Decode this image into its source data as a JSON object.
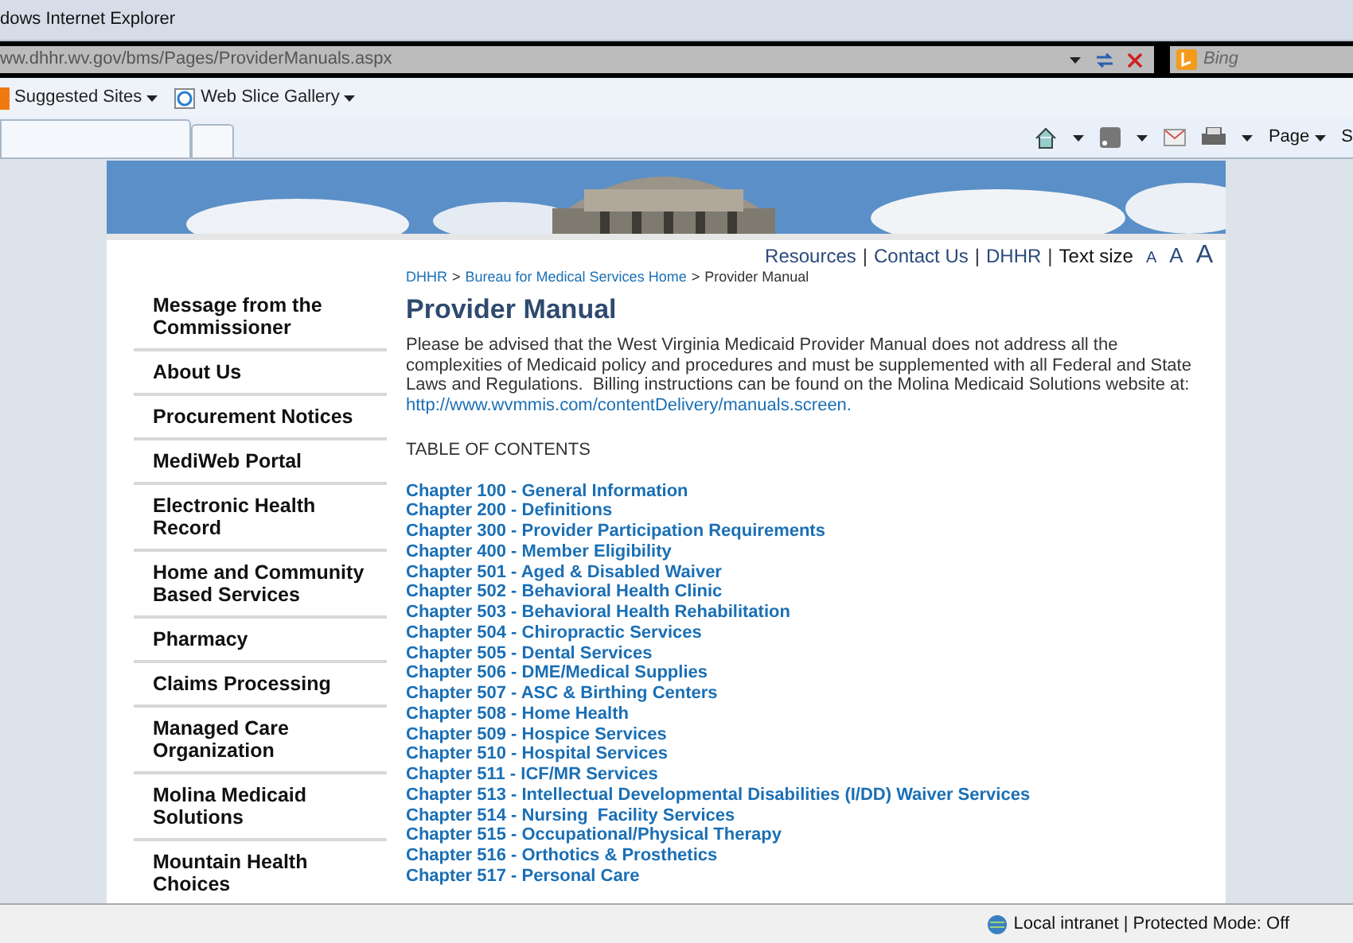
{
  "window": {
    "title": "dows Internet Explorer"
  },
  "address_bar": {
    "url": "ww.dhhr.wv.gov/bms/Pages/ProviderManuals.aspx"
  },
  "search": {
    "placeholder": "Bing"
  },
  "favorites_bar": [
    "Suggested Sites",
    "Web Slice Gallery"
  ],
  "command_bar": {
    "page_menu": "Page",
    "cut_menu": "S"
  },
  "utility_links": [
    {
      "kind": "link",
      "text": "Resources"
    },
    {
      "kind": "sep",
      "text": "|"
    },
    {
      "kind": "link",
      "text": "Contact Us"
    },
    {
      "kind": "sep",
      "text": "|"
    },
    {
      "kind": "link",
      "text": "DHHR"
    },
    {
      "kind": "sep",
      "text": "|"
    },
    {
      "kind": "label",
      "text": "Text size"
    }
  ],
  "text_size": [
    "A",
    "A",
    "A"
  ],
  "breadcrumb": [
    {
      "kind": "link",
      "text": "DHHR"
    },
    {
      "kind": "sep",
      "text": ">"
    },
    {
      "kind": "link",
      "text": "Bureau for Medical Services Home"
    },
    {
      "kind": "sep",
      "text": ">"
    },
    {
      "kind": "current",
      "text": "Provider Manual"
    }
  ],
  "sidebar": {
    "items": [
      "Message from the Commissioner",
      "About Us",
      "Procurement Notices",
      "MediWeb Portal",
      "Electronic Health Record",
      "Home and Community Based Services",
      "Pharmacy",
      "Claims Processing",
      "Managed Care Organization",
      "Molina Medicaid Solutions",
      "Mountain Health Choices"
    ]
  },
  "heading": "Provider Manual",
  "intro": "Please be advised that the West Virginia Medicaid Provider Manual does not address all the complexities of Medicaid policy and procedures and must be supplemented with all Federal and State Laws and Regulations.  Billing instructions can be found on the Molina Medicaid Solutions website at:",
  "intro_link": "http://www.wvmmis.com/contentDelivery/manuals.screen.",
  "toc_heading": "TABLE OF CONTENTS",
  "chapters": [
    "Chapter 100 - General Information",
    "Chapter 200 - Definitions",
    "Chapter 300 - Provider Participation Requirements",
    "Chapter 400 - Member Eligibility",
    "Chapter 501 - Aged & Disabled Waiver",
    "Chapter 502 - Behavioral Health Clinic",
    "Chapter 503 - Behavioral Health Rehabilitation",
    "Chapter 504 - Chiropractic Services",
    "Chapter 505 - Dental Services",
    "Chapter 506 - DME/Medical Supplies",
    "Chapter 507 - ASC & Birthing Centers",
    "Chapter 508 - Home Health",
    "Chapter 509 - Hospice Services",
    "Chapter 510 - Hospital Services",
    "Chapter 511 - ICF/MR Services",
    "Chapter 513 - Intellectual Developmental Disabilities (I/DD) Waiver Services",
    "Chapter 514 - Nursing  Facility Services",
    "Chapter 515 - Occupational/Physical Therapy",
    "Chapter 516 - Orthotics & Prosthetics",
    "Chapter 517 - Personal Care"
  ],
  "status_bar": {
    "zone": "Local intranet | Protected Mode: Off"
  }
}
